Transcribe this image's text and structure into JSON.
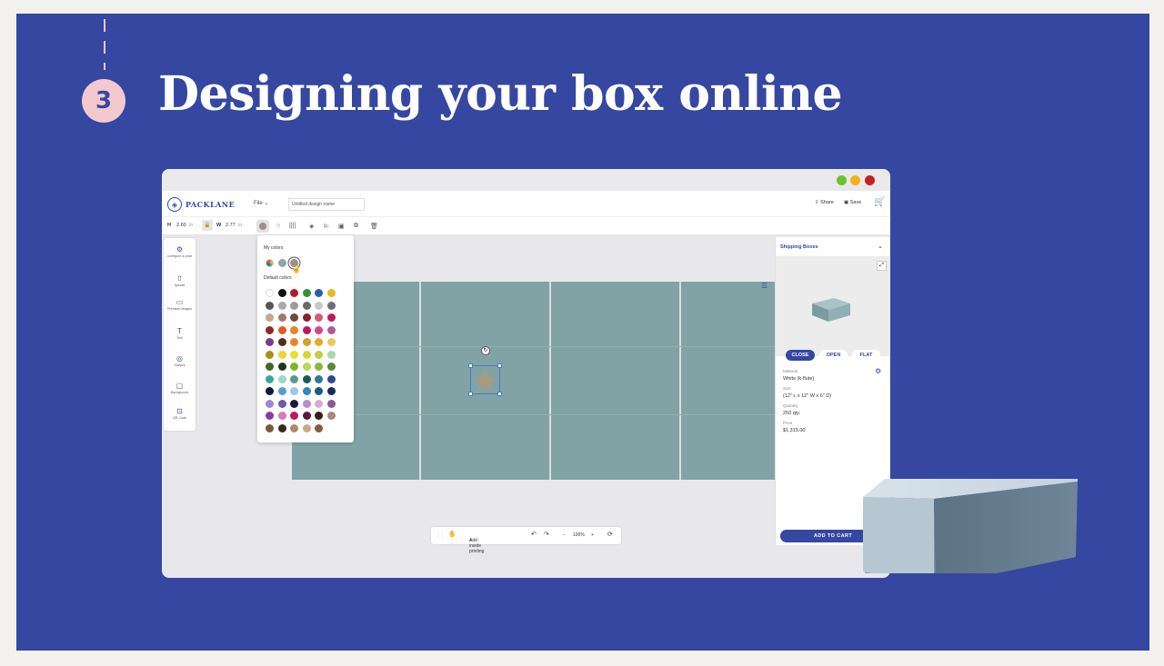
{
  "slide": {
    "step_number": "3",
    "heading": "Designing your box online"
  },
  "app": {
    "logo_text": "PACKLANE",
    "file_menu": "File",
    "design_name_placeholder": "Untitled design name",
    "share_label": "Share",
    "save_label": "Save",
    "toolbar": {
      "h_label": "H",
      "h_value": "2.60",
      "h_unit": "in",
      "w_label": "W",
      "w_value": "2.77",
      "w_unit": "in"
    },
    "leftbar": [
      {
        "label": "Configure & price",
        "icon": "gear-icon"
      },
      {
        "label": "Upload",
        "icon": "upload-icon"
      },
      {
        "label": "Premium images",
        "icon": "image-icon"
      },
      {
        "label": "Text",
        "icon": "text-icon"
      },
      {
        "label": "Shapes",
        "icon": "shapes-icon"
      },
      {
        "label": "Background",
        "icon": "background-icon"
      },
      {
        "label": "QR Code",
        "icon": "qr-code-icon"
      }
    ],
    "color_picker": {
      "my_colors_title": "My colors",
      "default_colors_title": "Default colors",
      "my_colors": [
        "#8fa6a8",
        "#9e8f85"
      ],
      "default_colors": [
        [
          "#ffffff",
          "#111111",
          "#b31b2b",
          "#3a8f3a",
          "#2a5ea8",
          "#e8b81e"
        ],
        [
          "#555555",
          "#a9a9a9",
          "#9c9c9c",
          "#6b6b6b",
          "#c8c8c8",
          "#6e6e78"
        ],
        [
          "#c9a38e",
          "#9e7b6b",
          "#6d4a3a",
          "#8a1f2a",
          "#d55b6f",
          "#c0195a"
        ],
        [
          "#8a2a2a",
          "#e05a2a",
          "#e8852a",
          "#c0195a",
          "#d04a8a",
          "#b05a9a"
        ],
        [
          "#7a3a8a",
          "#5a2a1a",
          "#e8852a",
          "#d4a020",
          "#e8a82a",
          "#e8c85a"
        ],
        [
          "#a8901a",
          "#e8d82a",
          "#e8e02a",
          "#d8d82a",
          "#c8c84a",
          "#a8d8a8"
        ],
        [
          "#3a6a2a",
          "#1a3a1a",
          "#7ab82a",
          "#b8d85a",
          "#8ab83a",
          "#5a8a3a"
        ],
        [
          "#3aa898",
          "#9ad8c8",
          "#5a9a8a",
          "#1a5a5a",
          "#2a7a9a",
          "#2a4a8a"
        ],
        [
          "#0a1a3a",
          "#5a9ad8",
          "#9ac8e8",
          "#2a8ab8",
          "#1a5a7a",
          "#1a2a5a"
        ],
        [
          "#9a8ad8",
          "#6a5aa8",
          "#1a1a3a",
          "#b88ac8",
          "#d8a8d8",
          "#8a5a9a"
        ],
        [
          "#8a3aa8",
          "#d87ab8",
          "#c0195a",
          "#5a1a3a",
          "#3a1a1a",
          "#a88a7a"
        ],
        [
          "#7a5a3a",
          "#3a2a1a",
          "#a88a6a",
          "#c8a888",
          "#8a5a3a"
        ]
      ]
    },
    "bottombar": {
      "add_inside_printing": "Add inside printing",
      "zoom": "100%"
    },
    "right_panel": {
      "title": "Shipping Boxes",
      "view_close": "CLOSE",
      "view_open": "OPEN",
      "view_flat": "FLAT",
      "material_label": "Material",
      "material_value": "White (k-flute)",
      "size_label": "Size",
      "size_value": "(12\" L x 12\" W x 6\" D)",
      "quantity_label": "Quantity",
      "quantity_value": "250 qty.",
      "price_label": "Price",
      "price_value": "$1,315.00",
      "add_to_cart": "ADD TO CART"
    },
    "colors": {
      "brand": "#3547a0",
      "box_panel": "#82a3a6",
      "traffic_green": "#6ac42a",
      "traffic_yellow": "#f0b21a",
      "traffic_red": "#c8201c"
    }
  }
}
